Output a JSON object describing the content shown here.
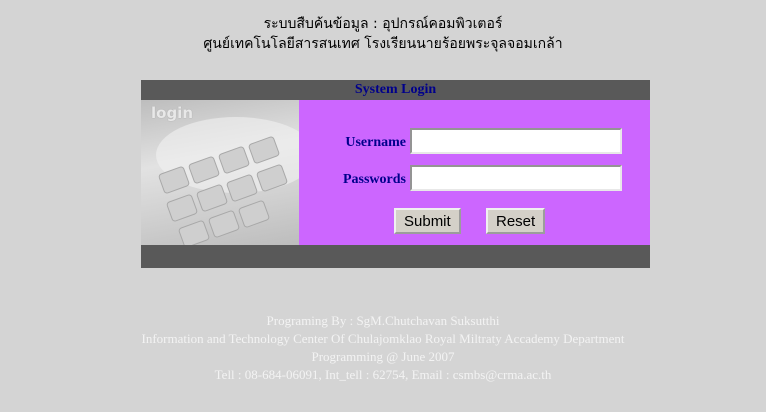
{
  "header": {
    "line1": "ระบบสืบค้นข้อมูล : อุปกรณ์คอมพิวเตอร์",
    "line2": "ศูนย์เทคโนโลยีสารสนเทศ โรงเรียนนายร้อยพระจุลจอมเกล้า"
  },
  "login": {
    "title": "System Login",
    "image_text": "login",
    "username_label": "Username",
    "password_label": "Passwords",
    "username_value": "",
    "password_value": "",
    "submit_label": "Submit",
    "reset_label": "Reset"
  },
  "footer": {
    "line1": "Programing By : SgM.Chutchavan Suksutthi",
    "line2": "Information and Technology Center Of Chulajomklao Royal Miltraty Accademy Department",
    "line3": "Programming @ June 2007",
    "line4": "Tell : 08-684-06091, Int_tell : 62754, Email : csmbs@crma.ac.th"
  },
  "colors": {
    "background": "#d4d4d4",
    "panel_dark": "#595959",
    "form_bg": "#cc66ff",
    "label_color": "#00008b"
  }
}
